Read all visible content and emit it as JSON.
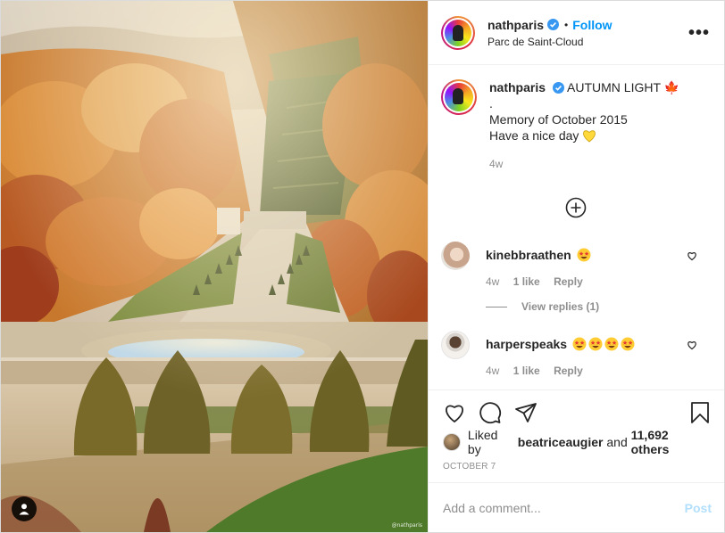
{
  "colors": {
    "link_blue": "#0095f6",
    "post_disabled": "#b2dffc",
    "muted": "#8e8e8e"
  },
  "header": {
    "username": "nathparis",
    "separator": "•",
    "follow_label": "Follow",
    "location": "Parc de Saint-Cloud",
    "more_icon": "more-horizontal-icon",
    "more_label": "•••"
  },
  "caption": {
    "username": "nathparis",
    "title": "AUTUMN LIGHT",
    "title_emoji": "🍁",
    "dot": ".",
    "line1": "Memory of October 2015",
    "line2": "Have a nice day",
    "heart_icon": "yellow-heart-icon",
    "age": "4w"
  },
  "comments": [
    {
      "username": "kinebbraathen",
      "emoji_count": 1,
      "age": "4w",
      "likes": "1 like",
      "reply": "Reply",
      "view_replies": "View replies (1)"
    },
    {
      "username": "harperspeaks",
      "emoji_count": 4,
      "age": "4w",
      "likes": "1 like",
      "reply": "Reply"
    }
  ],
  "actions": {
    "icons": [
      "heart-icon",
      "comment-icon",
      "share-icon",
      "bookmark-icon"
    ]
  },
  "likes": {
    "prefix": "Liked by",
    "user": "beatriceaugier",
    "and": "and",
    "count": "11,692 others"
  },
  "date": "OCTOBER 7",
  "add_comment": {
    "placeholder": "Add a comment...",
    "post_label": "Post"
  },
  "photo": {
    "watermark": "@nathparis",
    "user_tag_icon": "user-tag-icon"
  }
}
